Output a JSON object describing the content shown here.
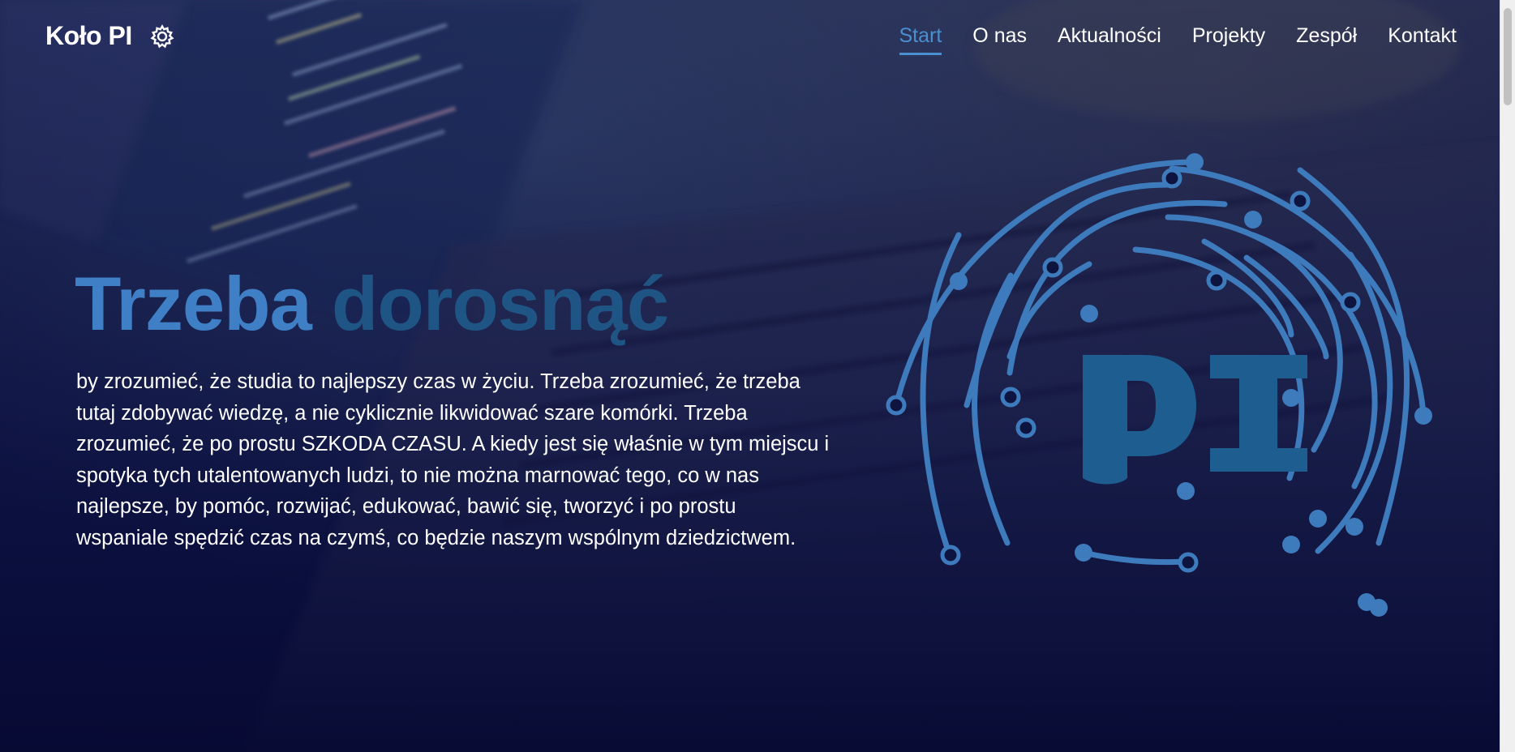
{
  "header": {
    "brand": "Koło PI",
    "brand_icon": "gear-icon",
    "nav": [
      {
        "label": "Start",
        "active": true
      },
      {
        "label": "O nas",
        "active": false
      },
      {
        "label": "Aktualności",
        "active": false
      },
      {
        "label": "Projekty",
        "active": false
      },
      {
        "label": "Zespół",
        "active": false
      },
      {
        "label": "Kontakt",
        "active": false
      }
    ]
  },
  "hero": {
    "title_part1": "Trzeba",
    "title_part2": "dorosnąć",
    "text": "by zrozumieć, że studia to najlepszy czas w życiu. Trzeba zrozumieć, że trzeba tutaj zdobywać wiedzę, a nie cyklicznie likwidować szare komórki. Trzeba zrozumieć, że po prostu SZKODA CZASU. A kiedy jest się właśnie w tym miejscu i spotyka tych utalentowanych ludzi, to nie można marnować tego, co w nas najlepsze, by pomóc, rozwijać, edukować, bawić się, tworzyć i po prostu wspaniale spędzić czas na czymś, co będzie naszym wspólnym dziedzictwem."
  },
  "logo": {
    "letters": "PI",
    "icon": "circuit-logo-icon"
  },
  "colors": {
    "accent": "#4a8fd0",
    "title_primary": "#3f7fc6",
    "title_secondary": "#1f5585",
    "logo_lines": "#3d7bbd",
    "logo_letters": "#1d5d8f",
    "background": "#0e1440"
  }
}
